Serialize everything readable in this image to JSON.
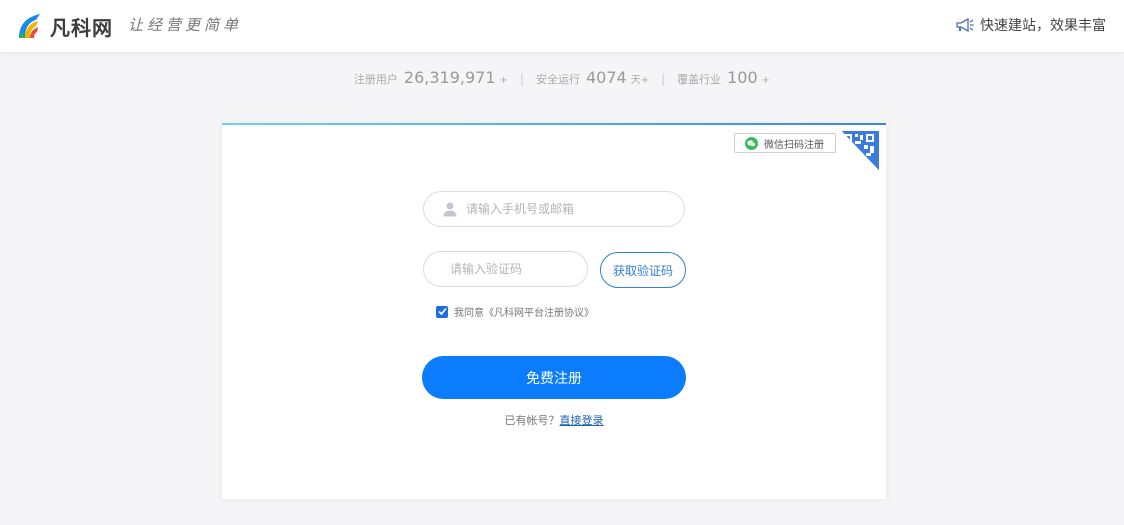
{
  "header": {
    "logo_text": "凡科网",
    "slogan": "让经营更简单",
    "tagline": "快速建站，效果丰富"
  },
  "stats": [
    {
      "label": "注册用户",
      "value": "26,319,971",
      "suffix": "+"
    },
    {
      "label": "安全运行",
      "value": "4074",
      "suffix": "天+"
    },
    {
      "label": "覆盖行业",
      "value": "100",
      "suffix": "+"
    }
  ],
  "separator": "|",
  "form": {
    "qr_label": "微信扫码注册",
    "phone_placeholder": "请输入手机号或邮箱",
    "code_placeholder": "请输入验证码",
    "get_code_label": "获取验证码",
    "agree_text": "我同意《凡科网平台注册协议》",
    "register_label": "免费注册",
    "have_account_text": "已有帐号？",
    "login_link": "直接登录"
  },
  "colors": {
    "primary": "#0a7cfc",
    "link": "#1a5fb4",
    "wechat": "#3cb95a"
  },
  "icons": {
    "logo": "fanke-logo-icon",
    "megaphone": "megaphone-icon",
    "wechat": "wechat-icon",
    "user": "user-icon",
    "shield": "shield-icon",
    "qr": "qr-corner-icon",
    "check": "check-icon"
  }
}
